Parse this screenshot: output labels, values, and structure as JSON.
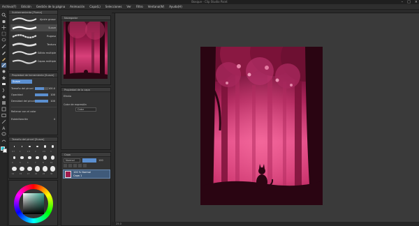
{
  "window": {
    "title": "Bosque - Clip Studio Paint"
  },
  "menu": {
    "items": [
      "Archivo(F)",
      "Edición",
      "Gestión de la página",
      "Animación",
      "Capa(L)",
      "Selecciones",
      "Ver",
      "Filtro",
      "Ventana(W)",
      "Ayuda(H)"
    ]
  },
  "brush_panel": {
    "title": "Subherramienta [Pluma]",
    "items": [
      {
        "label": "Ajuste grosor",
        "selected": false
      },
      {
        "label": "Suave",
        "selected": true
      },
      {
        "label": "Rugoso",
        "selected": false
      },
      {
        "label": "Textura",
        "selected": false
      },
      {
        "label": "Sólido multiple",
        "selected": false
      },
      {
        "label": "Capas múltiple",
        "selected": false
      }
    ]
  },
  "tool_property": {
    "title": "Propiedad de herramienta [Suave]",
    "tool_name": "Suave",
    "brush_size_label": "Tamaño del pincel",
    "brush_size_value": "100.0",
    "brush_size_fraction": 0.7,
    "opacity_label": "Opacidad",
    "opacity_value": "100",
    "opacity_fraction": 1.0,
    "density_label": "Densidad del pincel",
    "density_value": "100",
    "density_fraction": 1.0,
    "fill_label": "Rellenar con el color",
    "stabilization_label": "Estabilización",
    "stabilization_value": "4"
  },
  "brush_size_panel": {
    "title": "Tamaño del pincel [Suave]",
    "sizes": [
      "0.7",
      "1",
      "1.5",
      "2",
      "2.5",
      "3",
      "4",
      "5",
      "6",
      "7",
      "8",
      "10",
      "12",
      "15",
      "17",
      "20",
      "25",
      "30"
    ]
  },
  "navigator": {
    "title": "Navegador"
  },
  "layer_property": {
    "title": "Propiedad de la capa",
    "effect_label": "Efecto",
    "expression_label": "Color de expresión",
    "expression_value": "Color"
  },
  "layer_panel": {
    "title": "Capa",
    "blend_mode": "Normal",
    "opacity": "100",
    "layers": [
      {
        "name": "100 % Normal",
        "sub": "Capa 1"
      }
    ]
  },
  "colors": {
    "foreground": "#1cc8d8",
    "background": "#ffffff",
    "accent": "#5b8fd0",
    "art_sky_top": "#5a0d2a",
    "art_glow": "#e14a86",
    "art_silhouette": "#2a0512"
  },
  "status": {
    "zoom": "25.0"
  }
}
